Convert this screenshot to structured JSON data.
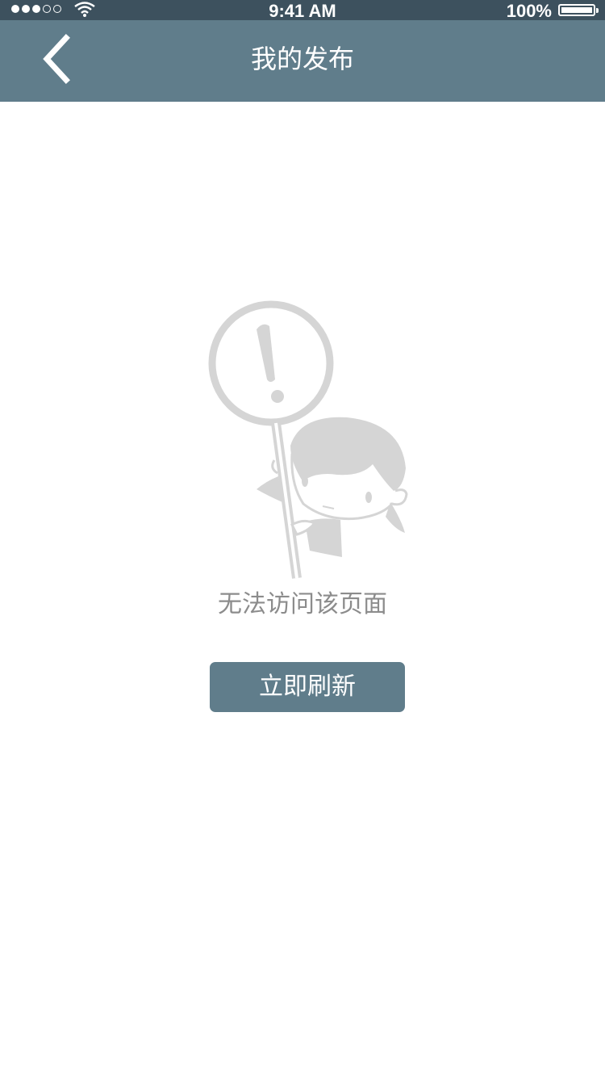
{
  "status_bar": {
    "time": "9:41 AM",
    "battery": "100%",
    "signal_bars_filled": 3,
    "signal_bars_total": 5
  },
  "nav": {
    "title": "我的发布",
    "back_icon": "chevron-left-icon"
  },
  "empty_state": {
    "illustration": "person-holding-warning-sign",
    "message": "无法访问该页面",
    "refresh_label": "立即刷新"
  },
  "colors": {
    "nav_bg": "#607d8b",
    "status_bg": "#3d515e",
    "button_bg": "#607d8b",
    "illustration_gray": "#d5d5d5",
    "message_text": "#8c8c8c"
  }
}
